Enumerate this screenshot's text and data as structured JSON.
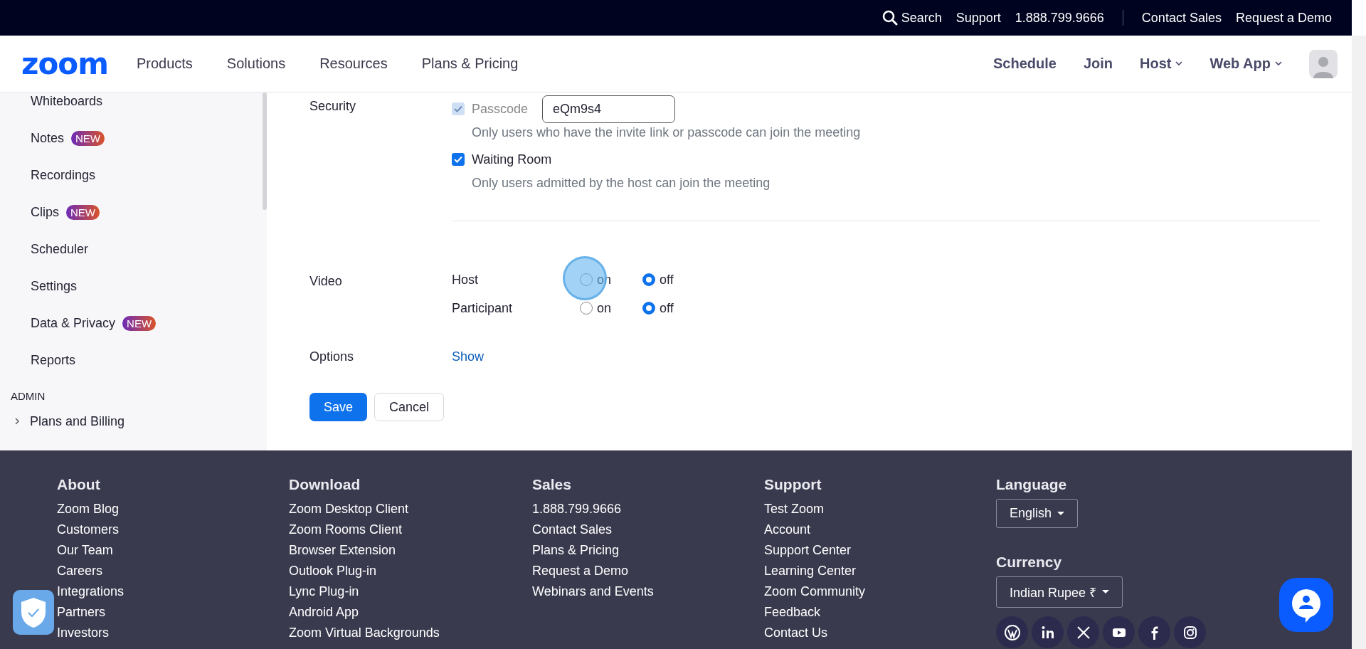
{
  "top_bar": {
    "search": "Search",
    "links": [
      "Support",
      "1.888.799.9666",
      "Contact Sales",
      "Request a Demo"
    ]
  },
  "nav": {
    "logo": "zoom",
    "left": [
      {
        "label": "Products",
        "dropdown": false
      },
      {
        "label": "Solutions",
        "dropdown": false
      },
      {
        "label": "Resources",
        "dropdown": false
      },
      {
        "label": "Plans & Pricing",
        "dropdown": false
      }
    ],
    "right": [
      {
        "label": "Schedule",
        "dropdown": false
      },
      {
        "label": "Join",
        "dropdown": false
      },
      {
        "label": "Host",
        "dropdown": true
      },
      {
        "label": "Web App",
        "dropdown": true
      }
    ]
  },
  "sidebar": {
    "items": [
      {
        "kind": "item",
        "label": "Whiteboards"
      },
      {
        "kind": "item",
        "label": "Notes",
        "badge": "NEW"
      },
      {
        "kind": "item",
        "label": "Recordings"
      },
      {
        "kind": "item",
        "label": "Clips",
        "badge": "NEW"
      },
      {
        "kind": "item",
        "label": "Scheduler"
      },
      {
        "kind": "item",
        "label": "Settings"
      },
      {
        "kind": "item",
        "label": "Data & Privacy",
        "badge": "NEW"
      },
      {
        "kind": "item",
        "label": "Reports"
      },
      {
        "kind": "header",
        "label": "ADMIN"
      },
      {
        "kind": "group",
        "label": "Plans and Billing",
        "expanded": false
      }
    ]
  },
  "settings": {
    "security": {
      "label": "Security",
      "options": [
        {
          "label": "Passcode",
          "checked": true,
          "disabled": true,
          "value": "eQm9s4",
          "hint": "Only users who have the invite link or passcode can join the meeting"
        },
        {
          "label": "Waiting Room",
          "checked": true,
          "disabled": false,
          "hint": "Only users admitted by the host can join the meeting"
        }
      ]
    },
    "video": {
      "label": "Video",
      "rows": [
        {
          "label": "Host",
          "choices": [
            {
              "label": "on",
              "selected": false
            },
            {
              "label": "off",
              "selected": true
            }
          ]
        },
        {
          "label": "Participant",
          "choices": [
            {
              "label": "on",
              "selected": false
            },
            {
              "label": "off",
              "selected": true
            }
          ]
        }
      ]
    },
    "options": {
      "label": "Options",
      "link": "Show"
    },
    "buttons": [
      {
        "label": "Save",
        "kind": "primary"
      },
      {
        "label": "Cancel",
        "kind": "secondary"
      }
    ]
  },
  "footer": {
    "columns": [
      {
        "heading": "About",
        "links": [
          "Zoom Blog",
          "Customers",
          "Our Team",
          "Careers",
          "Integrations",
          "Partners",
          "Investors"
        ]
      },
      {
        "heading": "Download",
        "links": [
          "Zoom Desktop Client",
          "Zoom Rooms Client",
          "Browser Extension",
          "Outlook Plug-in",
          "Lync Plug-in",
          "Android App",
          "Zoom Virtual Backgrounds"
        ]
      },
      {
        "heading": "Sales",
        "links": [
          "1.888.799.9666",
          "Contact Sales",
          "Plans & Pricing",
          "Request a Demo",
          "Webinars and Events"
        ]
      },
      {
        "heading": "Support",
        "links": [
          "Test Zoom",
          "Account",
          "Support Center",
          "Learning Center",
          "Zoom Community",
          "Feedback",
          "Contact Us"
        ]
      }
    ],
    "language": {
      "heading": "Language",
      "value": "English"
    },
    "currency": {
      "heading": "Currency",
      "value": "Indian Rupee ₹"
    }
  }
}
